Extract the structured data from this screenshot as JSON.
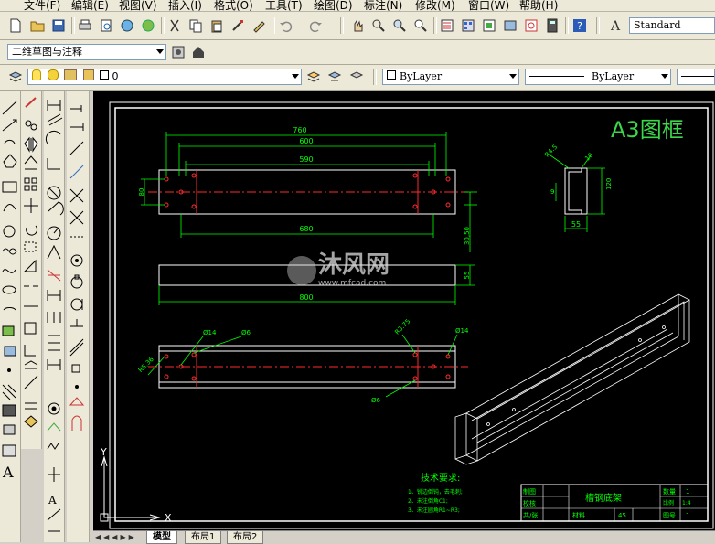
{
  "menu": [
    "文件(F)",
    "编辑(E)",
    "视图(V)",
    "插入(I)",
    "格式(O)",
    "工具(T)",
    "绘图(D)",
    "标注(N)",
    "修改(M)",
    "窗口(W)",
    "帮助(H)"
  ],
  "toolbar": {
    "text_style": "Standard",
    "workspace": "二维草图与注释",
    "layer": "0",
    "color": "ByLayer",
    "linetype": "ByLayer"
  },
  "drawing": {
    "frame_title": "A3图框",
    "watermark_name": "沐风网",
    "watermark_url": "www.mfcad.com",
    "dims_top": {
      "d760": "760",
      "d600": "600",
      "d590": "590",
      "d80": "80",
      "d680": "680",
      "d30_50": "30,50"
    },
    "dims_mid": {
      "d55": "55",
      "d800": "800"
    },
    "dims_bottom": {
      "phi14_a": "Ø14",
      "phi6_a": "Ø6",
      "r_a": "R5.36",
      "phi6_b": "Ø6",
      "r_b": "R3.75",
      "phi14_b": "Ø14"
    },
    "dims_profile": {
      "r_top": "R4.5",
      "d10": "10",
      "d120": "120",
      "d9": "9",
      "d55": "55"
    },
    "tech_title": "技术要求:",
    "tech_lines": [
      "1、锐边倒钝，去毛刺;",
      "2、未注倒角C1;",
      "3、未注圆角R1~R3;"
    ],
    "title_block": {
      "drawn": "制图",
      "check": "校核",
      "part_name": "槽钢底架",
      "qty_label": "数量",
      "qty": "1",
      "scale_label": "比例",
      "scale": "1:4",
      "sheet": "共/张",
      "material_label": "材料",
      "material": "45",
      "no_label": "图号",
      "no": "1"
    },
    "ucs_x": "X",
    "ucs_y": "Y"
  },
  "tabs": [
    "模型",
    "布局1",
    "布局2"
  ],
  "colors": {
    "canvas": "#000000",
    "line": "#ffffff",
    "dim": "#00ff00",
    "center": "#ff0000",
    "accent_title": "#3cd64a"
  }
}
